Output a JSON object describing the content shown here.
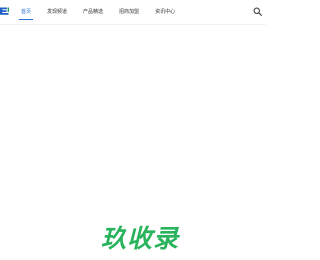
{
  "nav": {
    "items": [
      {
        "label": "首页",
        "active": true
      },
      {
        "label": "发现频道",
        "active": false
      },
      {
        "label": "产品精选",
        "active": false
      },
      {
        "label": "招商加盟",
        "active": false
      },
      {
        "label": "资讯中心",
        "active": false
      }
    ]
  },
  "icons": {
    "search": "search-icon",
    "logo": "logo-icon"
  },
  "brand": {
    "text": "玖收录"
  },
  "colors": {
    "accent": "#2a6fd6",
    "brand_green": "#29b35c",
    "text": "#333333",
    "background": "#ffffff"
  }
}
